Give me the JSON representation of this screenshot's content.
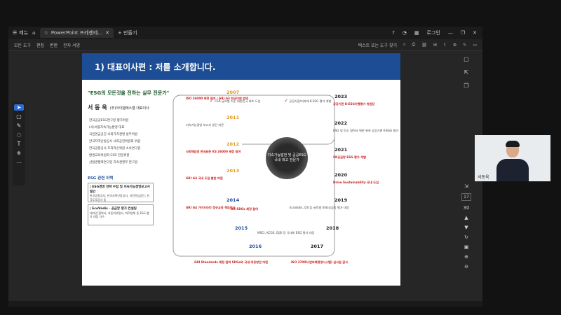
{
  "tabbar": {
    "menu": "메뉴",
    "tab_title": "PowerPoint 프레젠테...",
    "new_tab": "+ 만들기",
    "login": "로그인"
  },
  "toolbar": {
    "items": [
      "모든 도구",
      "편집",
      "변환",
      "전자 서명"
    ],
    "search": "텍스트 또는 도구 찾기"
  },
  "page": {
    "current": "17",
    "total": "30"
  },
  "slide": {
    "title": "1) 대표이사편 : 저를 소개합니다.",
    "tagline": "\"ESG의 모든것을 전하는 실무 전문가\"",
    "name": "서 동 욱",
    "org": "(주)아이템에스앨 대표이사",
    "roles": [
      "한국공공ESG연구원 평가위원",
      "(사)서울지속가능환경 대표",
      "국민연금공단 사회가치경영 실무위원",
      "한국지역난방공사 사회공헌위원회 위원",
      "한국공항공사 조직혁신위원 소속연구원",
      "환경교육위원회 CSR 전문위원",
      "산업경쟁력연구원 지속경영부 연구원"
    ],
    "esg_heading": "ESG 관련 이력",
    "box1_title": "| ESG경영 전략 수립 및 지속가능경영보고서 발간",
    "box1_text": "한국공항공사, 한국지역난방공사, 국민연금공단, 한국도로공사 등",
    "box2_title": "| EcoVadis · 공급망 평가 컨설팅",
    "box2_text": "대기업 협력사, 자동차부품사, 화학업체 등 ESG 평가 대응 다수",
    "center": "지속가능발전 및 공공ESG 국내 최고 전문가",
    "years": [
      {
        "year": "2007",
        "text": "ISO 26000 제정 참여 / GRI G3 한국어판 번역"
      },
      {
        "year": "2011",
        "text": "지속가능경영 보고서 발간 자문"
      },
      {
        "year": "2012",
        "text": "사회책임경 한국표준 KS 26000 제정 참여"
      },
      {
        "year": "2013",
        "text": "GRI G4 국내 도입 발판 마련"
      },
      {
        "year": "2014",
        "text": "GRI G4 가이드라인 정규교육 책임강사"
      },
      {
        "year": "2015",
        "text": "UN SDGs 제정 참여"
      },
      {
        "year": "2016",
        "text": "GRI Standards 제정 참여 SDGs와 국내 대응방안 마련"
      },
      {
        "year": "2017",
        "text": "ISO 37001(반부패경영시스템) 심사원 감사"
      },
      {
        "year": "2018",
        "text": "MSCI, KCGS, DJSI 등 국내외 ESG 평가 대응"
      },
      {
        "year": "2019",
        "text": "EcoVadis, DS 등 글로벌 ESG공급망 평가 대응"
      },
      {
        "year": "2020",
        "text": "Drive Sustainability 국내 도입"
      },
      {
        "year": "2021",
        "text": "SK공급망 ESG 평가 개발"
      },
      {
        "year": "2022",
        "text": "ESG 및 탄소 협력사 위한 위축 공공기관 K-ESG 평가"
      },
      {
        "year": "2023",
        "text": "공공기관 K-ESG이행평가 위원장"
      }
    ],
    "csr_text": "CSR 글로벌 기준 대한민국 최초 도입",
    "kesg_text": "공공기관/지자체 K-ESG 평가 개발"
  },
  "webcam": {
    "name": "서동욱"
  }
}
